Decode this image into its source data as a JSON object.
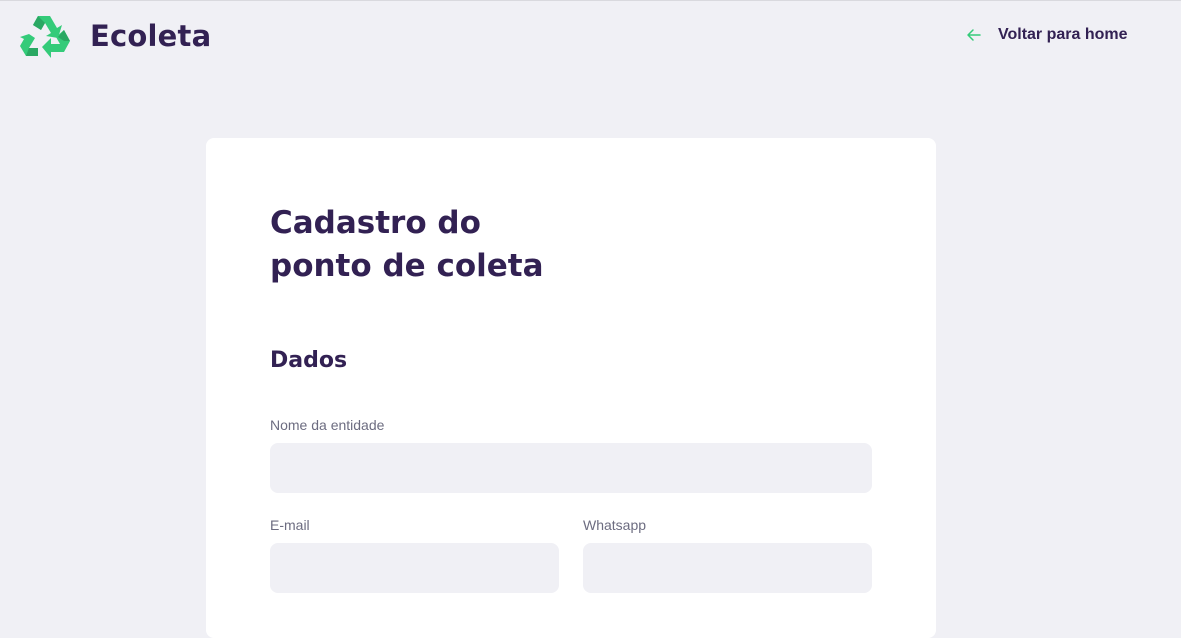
{
  "header": {
    "logo_text": "Ecoleta",
    "back_link_label": "Voltar para home",
    "logo_icon": "recycle-icon",
    "back_icon": "arrow-left-icon"
  },
  "form": {
    "title_line1": "Cadastro do",
    "title_line2": "ponto de coleta",
    "section_title": "Dados",
    "fields": {
      "name": {
        "label": "Nome da entidade",
        "value": ""
      },
      "email": {
        "label": "E-mail",
        "value": ""
      },
      "whatsapp": {
        "label": "Whatsapp",
        "value": ""
      }
    }
  },
  "colors": {
    "background": "#f0f0f5",
    "title": "#322153",
    "accent_green": "#34cb79",
    "label": "#6c6c80",
    "card": "#ffffff",
    "input_background": "#f0f0f5"
  }
}
